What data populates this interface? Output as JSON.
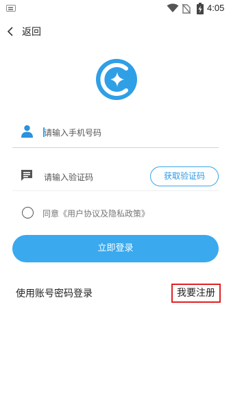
{
  "status_bar": {
    "time": "4:05"
  },
  "nav": {
    "back_label": "返回"
  },
  "form": {
    "phone_placeholder": "请输入手机号码",
    "code_placeholder": "请输入验证码",
    "get_code_label": "获取验证码",
    "agreement_text": "同意《用户协议及隐私政策》",
    "agreement_checked": false,
    "login_label": "立即登录"
  },
  "footer": {
    "password_login_label": "使用账号密码登录",
    "register_label": "我要注册"
  },
  "colors": {
    "accent": "#3aa9ee",
    "link_outline": "#e02020"
  }
}
